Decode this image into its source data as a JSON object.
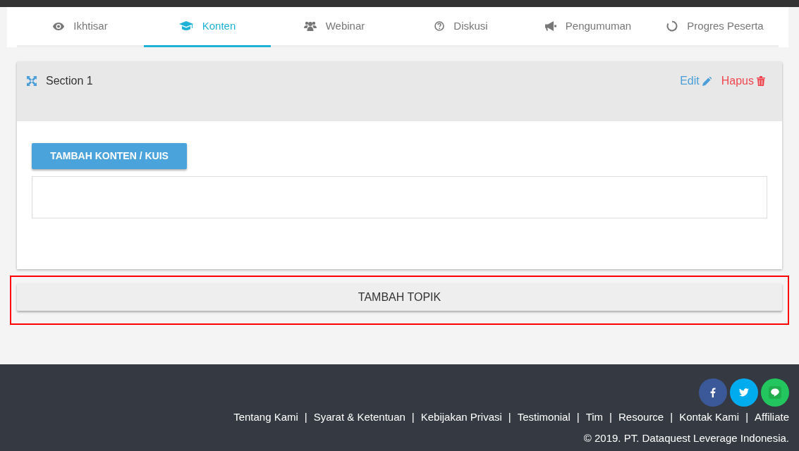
{
  "tabs": [
    {
      "label": "Ikhtisar",
      "selected": false
    },
    {
      "label": "Konten",
      "selected": true
    },
    {
      "label": "Webinar",
      "selected": false
    },
    {
      "label": "Diskusi",
      "selected": false
    },
    {
      "label": "Pengumuman",
      "selected": false
    },
    {
      "label": "Progres Peserta",
      "selected": false
    }
  ],
  "section": {
    "title": "Section 1",
    "edit": "Edit",
    "delete": "Hapus",
    "add_content_button": "TAMBAH KONTEN / KUIS"
  },
  "add_topic_button": "TAMBAH TOPIK",
  "footer": {
    "links": [
      {
        "kind": "link",
        "label": "Tentang Kami"
      },
      {
        "kind": "separator",
        "label": "|"
      },
      {
        "kind": "link",
        "label": "Syarat & Ketentuan"
      },
      {
        "kind": "separator",
        "label": "|"
      },
      {
        "kind": "link",
        "label": "Kebijakan Privasi"
      },
      {
        "kind": "separator",
        "label": "|"
      },
      {
        "kind": "link",
        "label": "Testimonial"
      },
      {
        "kind": "separator",
        "label": "|"
      },
      {
        "kind": "link",
        "label": "Tim"
      },
      {
        "kind": "separator",
        "label": "|"
      },
      {
        "kind": "link",
        "label": "Resource"
      },
      {
        "kind": "separator",
        "label": "|"
      },
      {
        "kind": "link",
        "label": "Kontak Kami"
      },
      {
        "kind": "separator",
        "label": "|"
      },
      {
        "kind": "link",
        "label": "Affiliate"
      }
    ],
    "copyright": "© 2019. PT. Dataquest Leverage Indonesia."
  }
}
